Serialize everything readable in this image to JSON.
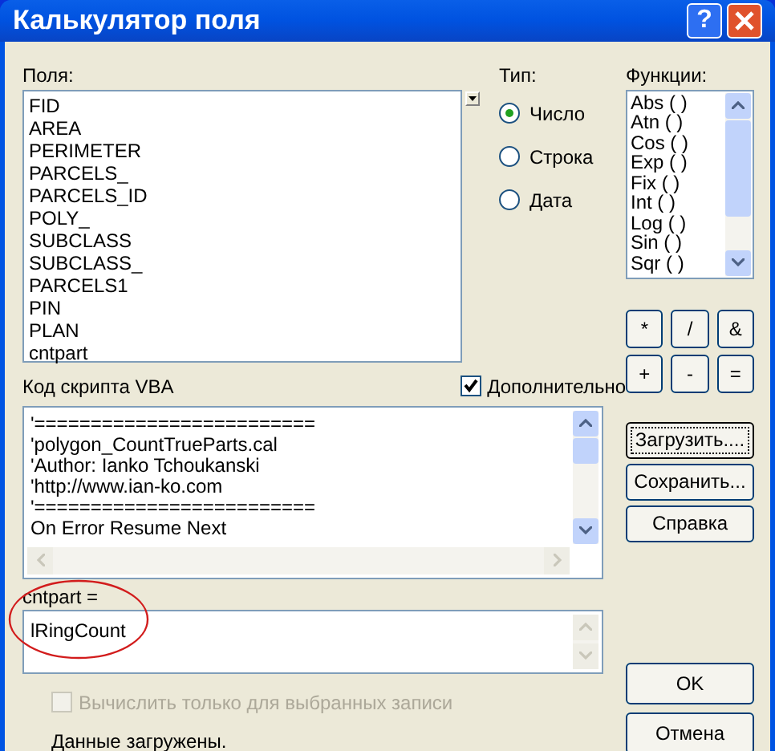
{
  "window": {
    "title": "Калькулятор поля",
    "help": "?"
  },
  "fields": {
    "label": "Поля:",
    "items": [
      "FID",
      "AREA",
      "PERIMETER",
      "PARCELS_",
      "PARCELS_ID",
      "POLY_",
      "SUBCLASS",
      "SUBCLASS_",
      "PARCELS1",
      "PIN",
      "PLAN",
      "cntpart"
    ]
  },
  "type": {
    "label": "Тип:",
    "options": [
      {
        "label": "Число",
        "selected": true
      },
      {
        "label": "Строка",
        "selected": false
      },
      {
        "label": "Дата",
        "selected": false
      }
    ]
  },
  "functions": {
    "label": "Функции:",
    "items": [
      "Abs ( )",
      "Atn ( )",
      "Cos ( )",
      "Exp ( )",
      "Fix ( )",
      "Int ( )",
      "Log ( )",
      "Sin ( )",
      "Sqr ( )"
    ]
  },
  "operators": [
    "*",
    "/",
    "&",
    "+",
    "-",
    "="
  ],
  "script": {
    "label": "Код скрипта VBA",
    "advanced": {
      "label": "Дополнительно",
      "checked": true
    },
    "lines": [
      "'=========================",
      "'polygon_CountTrueParts.cal",
      "'Author: Ianko Tchoukanski",
      "'http://www.ian-ko.com",
      "'=========================",
      "On Error Resume Next"
    ]
  },
  "expression": {
    "label": "cntpart =",
    "value": "lRingCount"
  },
  "selected_only": {
    "label": "Вычислить только для выбранных записи",
    "checked": false,
    "disabled": true
  },
  "status": "Данные загружены.",
  "buttons": [
    {
      "label": "Загрузить....",
      "focused": true
    },
    {
      "label": "Сохранить...",
      "focused": false
    },
    {
      "label": "Справка",
      "focused": false
    }
  ],
  "dialog_buttons": [
    "OK",
    "Отмена"
  ]
}
